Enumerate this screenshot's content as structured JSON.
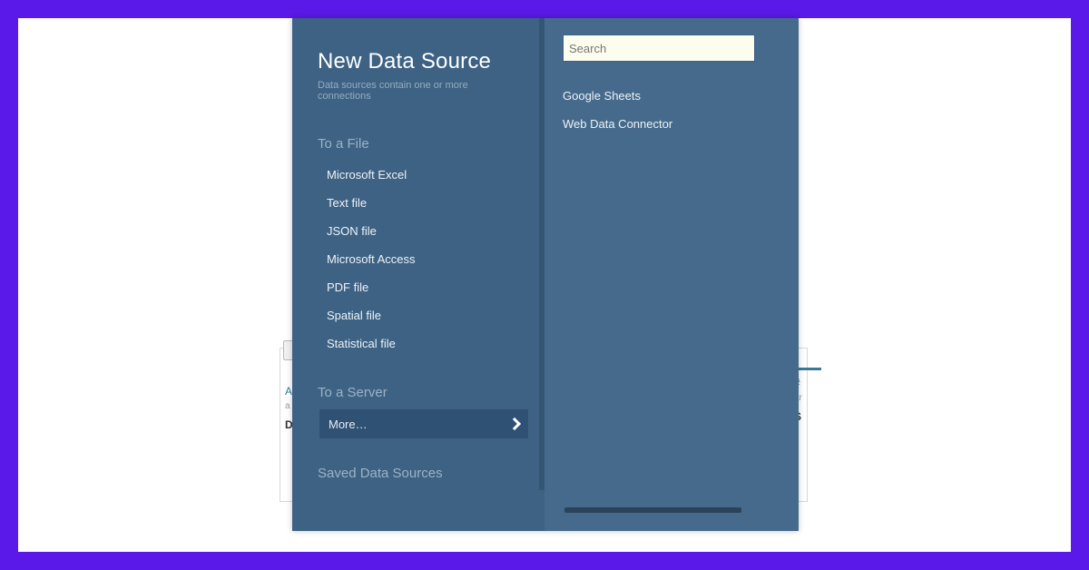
{
  "dialog": {
    "title": "New Data Source",
    "subtitle": "Data sources contain one or more connections",
    "sections": {
      "to_file": {
        "heading": "To a File",
        "items": [
          "Microsoft Excel",
          "Text file",
          "JSON file",
          "Microsoft Access",
          "PDF file",
          "Spatial file",
          "Statistical file"
        ]
      },
      "to_server": {
        "heading": "To a Server",
        "more_label": "More…"
      },
      "saved": {
        "heading": "Saved Data Sources"
      }
    }
  },
  "right": {
    "search_placeholder": "Search",
    "server_items": [
      "Google Sheets",
      "Web Data Connector"
    ]
  },
  "bg": {
    "left_head": "A",
    "left_sub": "a",
    "left_val": "D",
    "right_head": "#",
    "right_sub": "ar",
    "right_val": "S"
  }
}
